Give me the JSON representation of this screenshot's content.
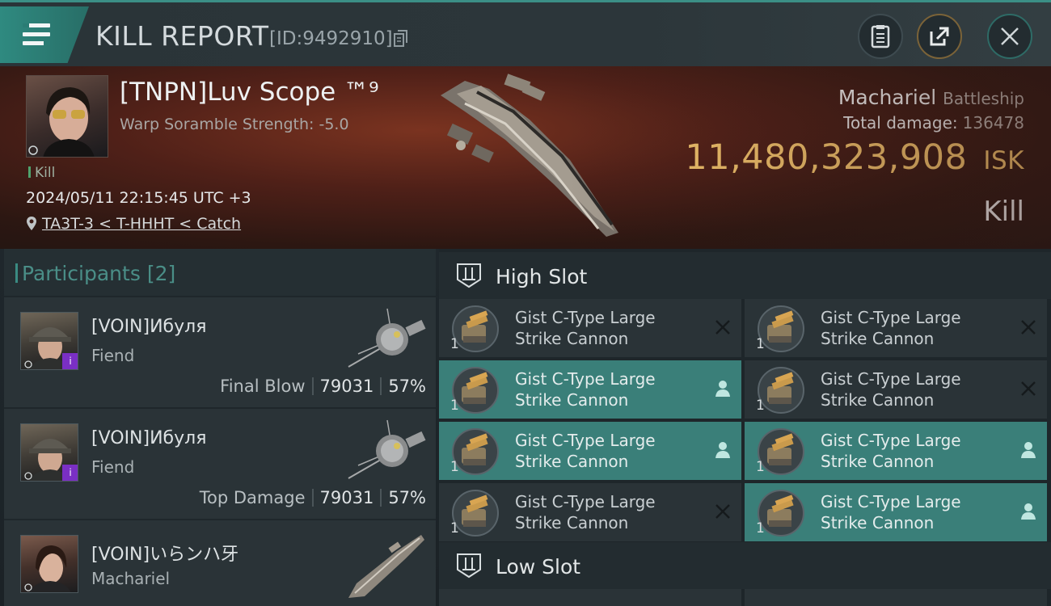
{
  "header": {
    "title": "KILL REPORT",
    "report_id": "[ID:9492910]"
  },
  "victim": {
    "name": "[TNPN]Luv Scope ™⁹",
    "warp_scramble": "Warp Soramble Strength: -5.0",
    "tag": "Kill",
    "timestamp": "2024/05/11 22:15:45 UTC +3",
    "location": "TA3T-3 < T-HHHT < Catch",
    "ship_name": "Machariel",
    "ship_class": "Battleship",
    "total_damage_label": "Total damage:",
    "total_damage_value": "136478",
    "isk_value": "11,480,323,908",
    "isk_unit": "ISK",
    "result": "Kill"
  },
  "participants": {
    "label": "Participants",
    "count": "[2]",
    "rows": [
      {
        "name": "[VOIN]Ибуля",
        "ship": "Fiend",
        "role": "Final Blow",
        "damage": "79031",
        "percent": "57%"
      },
      {
        "name": "[VOIN]Ибуля",
        "ship": "Fiend",
        "role": "Top Damage",
        "damage": "79031",
        "percent": "57%"
      },
      {
        "name": "[VOIN]いらンハ牙",
        "ship": "Machariel",
        "role": "",
        "damage": "",
        "percent": ""
      }
    ]
  },
  "high_slot": {
    "label": "High Slot",
    "modules": [
      {
        "line1": "Gist C-Type Large",
        "line2": "Strike Cannon",
        "qty": "1",
        "state": "destroyed"
      },
      {
        "line1": "Gist C-Type Large",
        "line2": "Strike Cannon",
        "qty": "1",
        "state": "destroyed"
      },
      {
        "line1": "Gist C-Type Large",
        "line2": "Strike Cannon",
        "qty": "1",
        "state": "dropped"
      },
      {
        "line1": "Gist C-Type Large",
        "line2": "Strike Cannon",
        "qty": "1",
        "state": "destroyed"
      },
      {
        "line1": "Gist C-Type Large",
        "line2": "Strike Cannon",
        "qty": "1",
        "state": "dropped"
      },
      {
        "line1": "Gist C-Type Large",
        "line2": "Strike Cannon",
        "qty": "1",
        "state": "dropped"
      },
      {
        "line1": "Gist C-Type Large",
        "line2": "Strike Cannon",
        "qty": "1",
        "state": "destroyed"
      },
      {
        "line1": "Gist C-Type Large",
        "line2": "Strike Cannon",
        "qty": "1",
        "state": "dropped"
      }
    ]
  },
  "low_slot": {
    "label": "Low Slot"
  },
  "icons": {
    "menu": "hamburger-menu-icon",
    "copy": "copy-icon",
    "clipboard": "clipboard-icon",
    "share": "share-icon",
    "close": "close-icon",
    "location": "location-pin-icon",
    "slot": "turret-slot-icon",
    "destroyed": "x-destroyed-icon",
    "dropped": "person-dropped-icon"
  },
  "colors": {
    "accent": "#3a8b82",
    "isk": "#f2c46d",
    "active_row": "#3a7f79"
  }
}
